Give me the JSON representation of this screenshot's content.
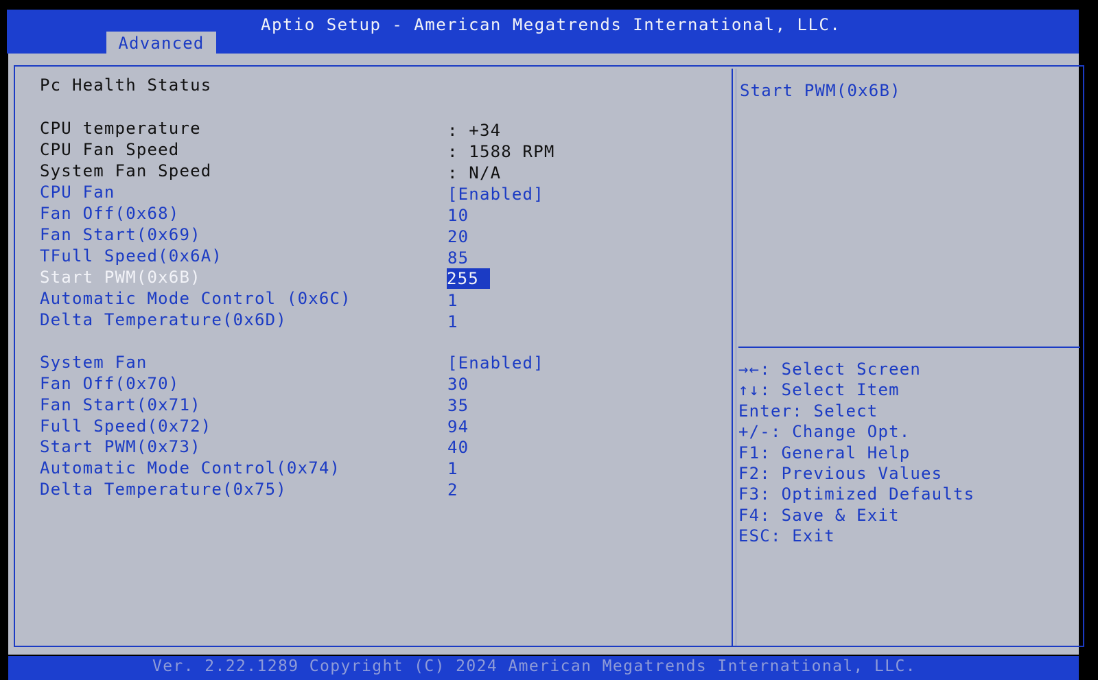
{
  "app_title": "Aptio Setup - American Megatrends International, LLC.",
  "tab": "Advanced",
  "section_title": "Pc Health Status",
  "info_rows": [
    {
      "label": "CPU temperature",
      "value": ": +34"
    },
    {
      "label": "CPU Fan Speed",
      "value": ": 1588 RPM"
    },
    {
      "label": "System Fan Speed",
      "value": ": N/A"
    }
  ],
  "cpu_fan_rows": [
    {
      "label": "CPU Fan",
      "value": "[Enabled]"
    },
    {
      "label": "Fan Off(0x68)",
      "value": "10"
    },
    {
      "label": "Fan Start(0x69)",
      "value": "20"
    },
    {
      "label": "TFull Speed(0x6A)",
      "value": "85"
    },
    {
      "label": "Start PWM(0x6B)",
      "value": "255"
    },
    {
      "label": "Automatic Mode Control (0x6C)",
      "value": "1"
    },
    {
      "label": "Delta Temperature(0x6D)",
      "value": "1"
    }
  ],
  "system_fan_rows": [
    {
      "label": "System Fan",
      "value": "[Enabled]"
    },
    {
      "label": "Fan Off(0x70)",
      "value": "30"
    },
    {
      "label": "Fan Start(0x71)",
      "value": "35"
    },
    {
      "label": "Full Speed(0x72)",
      "value": "94"
    },
    {
      "label": "Start PWM(0x73)",
      "value": "40"
    },
    {
      "label": "Automatic Mode Control(0x74)",
      "value": "1"
    },
    {
      "label": "Delta Temperature(0x75)",
      "value": "2"
    }
  ],
  "help_title": "Start PWM(0x6B)",
  "keys": [
    "→←: Select Screen",
    "↑↓: Select Item",
    "Enter: Select",
    "+/-: Change Opt.",
    "F1: General Help",
    "F2: Previous Values",
    "F3: Optimized Defaults",
    "F4: Save & Exit",
    "ESC: Exit"
  ],
  "footer": "Ver. 2.22.1289 Copyright (C) 2024 American Megatrends International, LLC.",
  "colors": {
    "bios_blue": "#1b3bc4",
    "panel_gray": "#b9bdc9",
    "highlight_text": "#f2f3f8"
  }
}
